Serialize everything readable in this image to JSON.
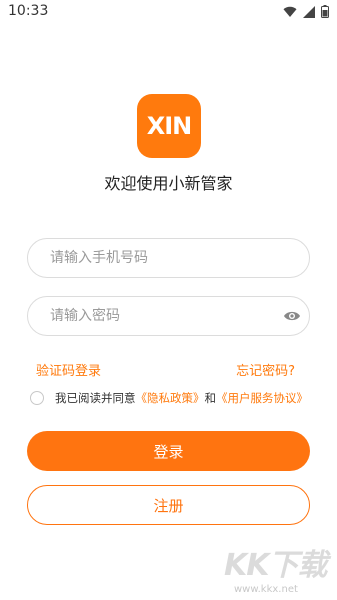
{
  "status_bar": {
    "time": "10:33",
    "icons": [
      "wifi-icon",
      "signal-icon",
      "battery-icon"
    ]
  },
  "app": {
    "logo_text": "XIN",
    "welcome": "欢迎使用小新管家",
    "brand_color": "#ff7410"
  },
  "form": {
    "phone_placeholder": "请输入手机号码",
    "password_placeholder": "请输入密码",
    "sms_login": "验证码登录",
    "forgot_password": "忘记密码?",
    "agreement": {
      "prefix": "我已阅读并同意",
      "privacy": "《隐私政策》",
      "and": "和",
      "terms": "《用户服务协议》"
    },
    "login_button": "登录",
    "register_button": "注册"
  },
  "watermark": {
    "logo": "KK下载",
    "url": "www.kkx.net"
  }
}
